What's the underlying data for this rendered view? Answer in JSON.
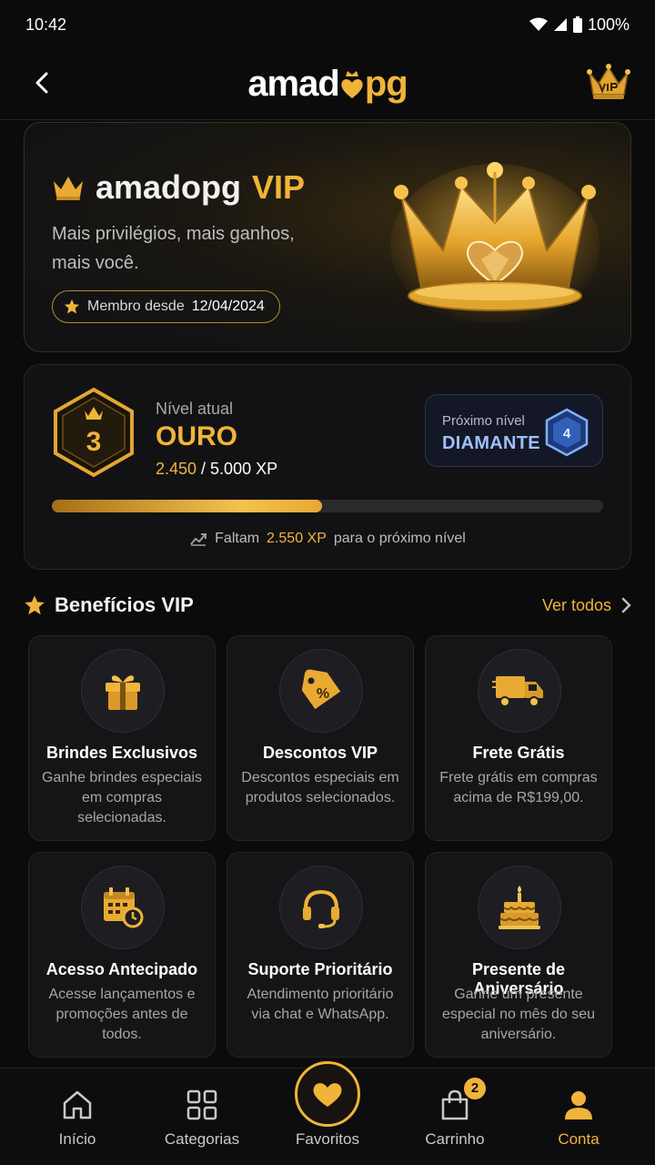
{
  "status_bar": {
    "time": "10:42",
    "battery": "100%"
  },
  "header": {
    "logo_left": "amad",
    "logo_right": "pg"
  },
  "hero": {
    "brand": "amadopg",
    "vip": "VIP",
    "subtitle": "Mais privilégios, mais ganhos, mais você.",
    "member_label": "Membro desde",
    "member_date": "12/04/2024"
  },
  "level": {
    "badge_number": "3",
    "caption": "Nível atual",
    "name": "OURO",
    "xp_current": "2.450",
    "xp_total": " / 5.000 XP",
    "progress": 0.49,
    "next_caption": "Próximo nível",
    "next_name": "DIAMANTE",
    "next_badge_number": "4",
    "note_before": "Faltam",
    "note_xp": "2.550 XP",
    "note_after": "para o próximo nível"
  },
  "benefits": {
    "title": "Benefícios VIP",
    "see_all": "Ver todos",
    "items": [
      {
        "title": "Brindes Exclusivos",
        "desc": "Ganhe brindes especiais em compras selecionadas.",
        "icon": "gift-icon"
      },
      {
        "title": "Descontos VIP",
        "desc": "Descontos especiais em produtos selecionados.",
        "icon": "discount-tag-icon"
      },
      {
        "title": "Frete Grátis",
        "desc": "Frete grátis em compras acima de R$199,00.",
        "icon": "delivery-truck-icon"
      },
      {
        "title": "Acesso Antecipado",
        "desc": "Acesse lançamentos e promoções antes de todos.",
        "icon": "calendar-clock-icon"
      },
      {
        "title": "Suporte Prioritário",
        "desc": "Atendimento prioritário via chat e WhatsApp.",
        "icon": "headset-icon"
      },
      {
        "title": "Presente de Aniversário",
        "desc": "Ganhe um presente especial no mês do seu aniversário.",
        "icon": "birthday-cake-icon"
      }
    ]
  },
  "nav": {
    "items": [
      {
        "label": "Início",
        "icon": "home-icon"
      },
      {
        "label": "Categorias",
        "icon": "grid-icon"
      },
      {
        "label": "Favoritos",
        "icon": "heart-icon"
      },
      {
        "label": "Carrinho",
        "icon": "shopping-bag-icon",
        "badge": "2"
      },
      {
        "label": "Conta",
        "icon": "user-icon",
        "active": true
      }
    ]
  },
  "colors": {
    "accent": "#f0b43a",
    "background": "#0b0b0c",
    "diamond": "#9ec0ff"
  }
}
